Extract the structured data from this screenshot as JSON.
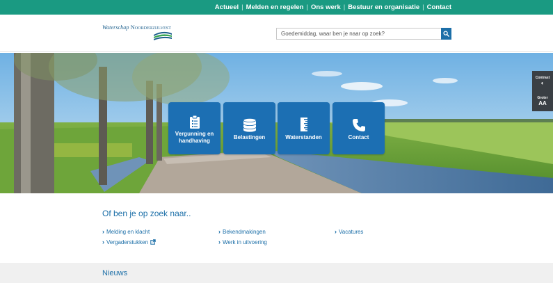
{
  "topnav": {
    "items": [
      "Actueel",
      "Melden en regelen",
      "Ons werk",
      "Bestuur en organisatie",
      "Contact"
    ],
    "separator": "|"
  },
  "header": {
    "logo_text_main": "Waterschap",
    "logo_text_caps": "Noorderzijlvest",
    "search_placeholder": "Goedemiddag, waar ben je naar op zoek?"
  },
  "tiles": [
    {
      "label_line1": "Vergunning en",
      "label_line2": "handhaving",
      "icon": "clipboard-icon"
    },
    {
      "label_line1": "Belastingen",
      "label_line2": "",
      "icon": "coins-icon"
    },
    {
      "label_line1": "Waterstanden",
      "label_line2": "",
      "icon": "ruler-icon"
    },
    {
      "label_line1": "Contact",
      "label_line2": "",
      "icon": "phone-icon"
    }
  ],
  "side_tools": {
    "contrast_label": "Contrast",
    "contrast_icon": "◐",
    "size_label": "Groter",
    "size_icon": "AA"
  },
  "links": {
    "title": "Of ben je op zoek naar..",
    "items": [
      "Melding en klacht",
      "Vergaderstukken",
      "Bekendmakingen",
      "Werk in uitvoering",
      "Vacatures"
    ]
  },
  "news": {
    "title": "Nieuws"
  },
  "colors": {
    "topbar": "#1a9a82",
    "accent_blue": "#1c6fa8",
    "tile_blue": "#1c6fb3"
  }
}
